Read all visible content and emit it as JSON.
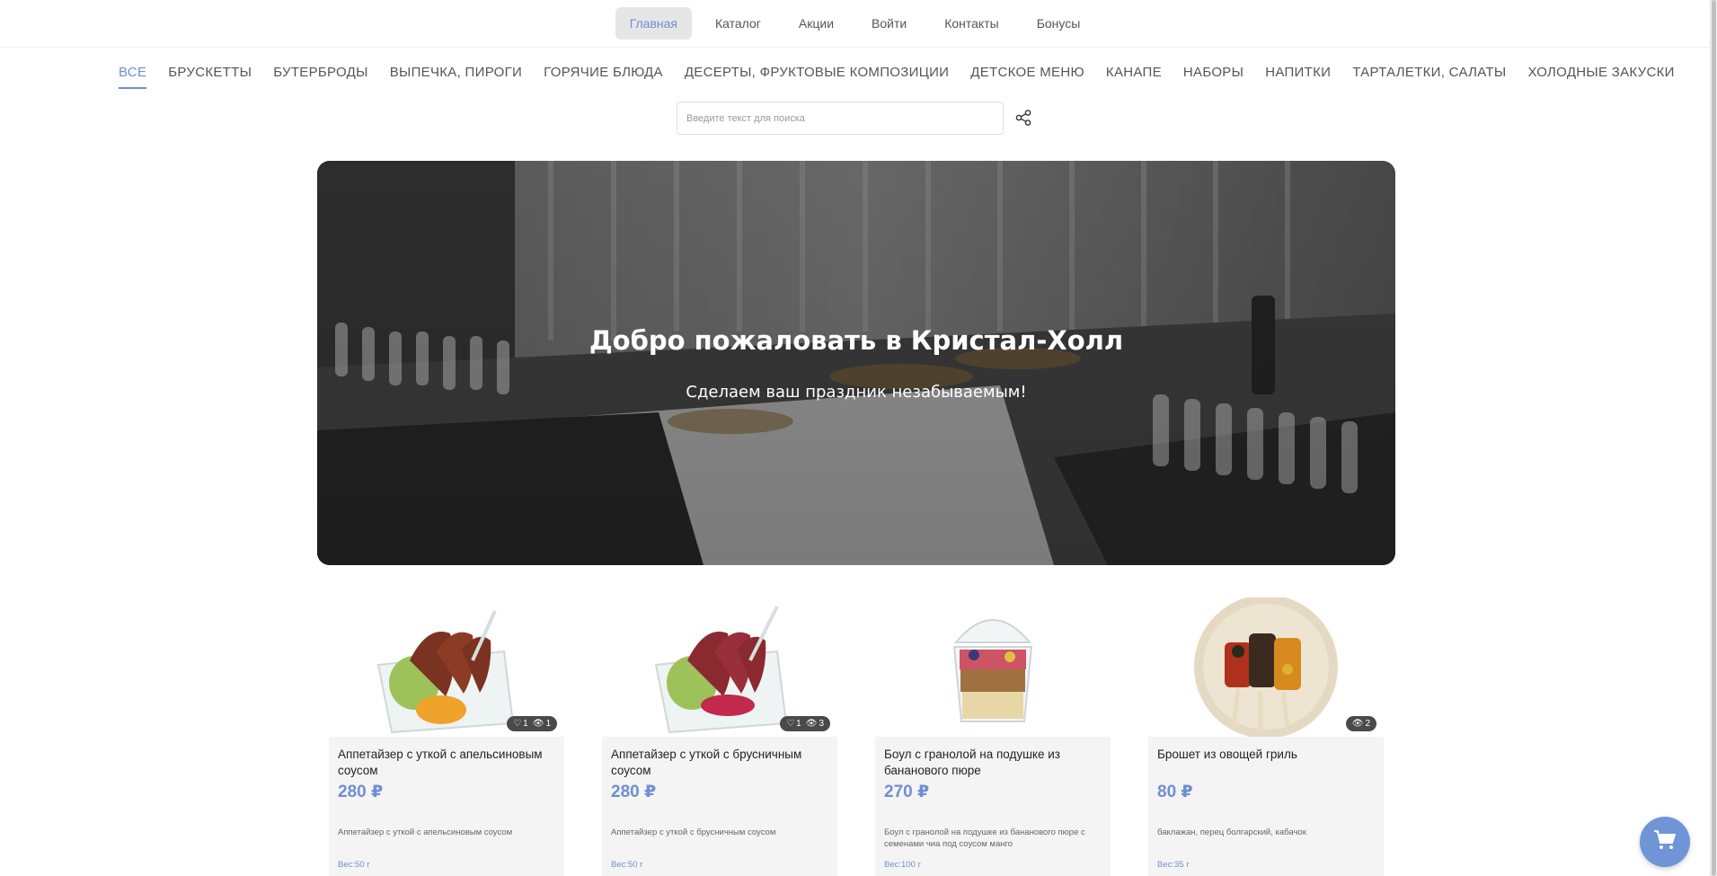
{
  "topnav": {
    "items": [
      {
        "label": "Главная",
        "active": true
      },
      {
        "label": "Каталог"
      },
      {
        "label": "Акции"
      },
      {
        "label": "Войти"
      },
      {
        "label": "Контакты"
      },
      {
        "label": "Бонусы"
      }
    ]
  },
  "categories": {
    "items": [
      {
        "label": "ВСЕ",
        "active": true
      },
      {
        "label": "БРУСКЕТТЫ"
      },
      {
        "label": "БУТЕРБРОДЫ"
      },
      {
        "label": "ВЫПЕЧКА, ПИРОГИ"
      },
      {
        "label": "ГОРЯЧИЕ БЛЮДА"
      },
      {
        "label": "ДЕСЕРТЫ, ФРУКТОВЫЕ КОМПОЗИЦИИ"
      },
      {
        "label": "ДЕТСКОЕ МЕНЮ"
      },
      {
        "label": "КАНАПЕ"
      },
      {
        "label": "НАБОРЫ"
      },
      {
        "label": "НАПИТКИ"
      },
      {
        "label": "ТАРТАЛЕТКИ, САЛАТЫ"
      },
      {
        "label": "ХОЛОДНЫЕ ЗАКУСКИ"
      }
    ]
  },
  "search": {
    "placeholder": "Введите текст для поиска",
    "share_icon": "share-icon"
  },
  "hero": {
    "title": "Добро пожаловать в Кристал-Холл",
    "subtitle": "Сделаем ваш праздник незабываемым!"
  },
  "products": [
    {
      "name": "Аппетайзер с уткой с апельсиновым соусом",
      "price": "280 ₽",
      "likes": "1",
      "views": "1",
      "description": "Аппетайзер с уткой с апельсиновым соусом",
      "weight": "Вес:50 г"
    },
    {
      "name": "Аппетайзер с уткой с брусничным соусом",
      "price": "280 ₽",
      "likes": "1",
      "views": "3",
      "description": "Аппетайзер с уткой с брусничным соусом",
      "weight": "Вес:50 г"
    },
    {
      "name": "Боул с гранолой на подушке из бананового пюре",
      "price": "270 ₽",
      "likes": null,
      "views": null,
      "description": "Боул с гранолой на подушке из бананового пюре с семенами чиа под соусом манго",
      "weight": "Вес:100 г"
    },
    {
      "name": "Брошет из овощей гриль",
      "price": "80 ₽",
      "likes": null,
      "views": "2",
      "description": "баклажан, перец болгарский, кабачок",
      "weight": "Вес:35 г"
    }
  ],
  "cart": {
    "icon": "cart-icon"
  },
  "colors": {
    "accent": "#6f8fd1",
    "cart_button": "#6f95d6",
    "card_bg": "#f4f4f4"
  }
}
